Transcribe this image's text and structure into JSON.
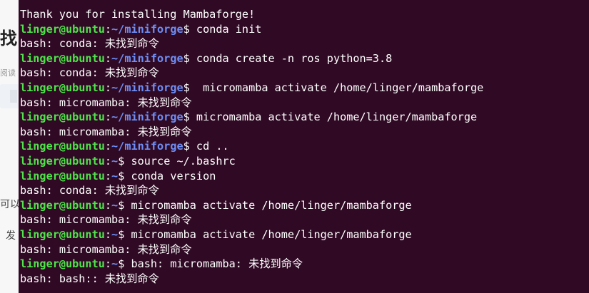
{
  "background_page": {
    "title_fragment": "找",
    "read_fragment": "阅读",
    "fragment_ke": "可以",
    "fragment_fa": "发"
  },
  "terminal": {
    "colors": {
      "background": "#300a24",
      "user": "#4ee44a",
      "path": "#6f8ff7",
      "text": "#ffffff"
    },
    "lines": [
      {
        "type": "output",
        "text": "Thank you for installing Mambaforge!"
      },
      {
        "type": "prompt",
        "user": "linger@ubuntu",
        "sep": ":",
        "path": "~/miniforge",
        "symbol": "$",
        "command": " conda init"
      },
      {
        "type": "output",
        "text": "bash: conda: 未找到命令"
      },
      {
        "type": "prompt",
        "user": "linger@ubuntu",
        "sep": ":",
        "path": "~/miniforge",
        "symbol": "$",
        "command": " conda create -n ros python=3.8"
      },
      {
        "type": "output",
        "text": "bash: conda: 未找到命令"
      },
      {
        "type": "prompt",
        "user": "linger@ubuntu",
        "sep": ":",
        "path": "~/miniforge",
        "symbol": "$",
        "command": "  micromamba activate /home/linger/mambaforge"
      },
      {
        "type": "output",
        "text": "bash: micromamba: 未找到命令"
      },
      {
        "type": "prompt",
        "user": "linger@ubuntu",
        "sep": ":",
        "path": "~/miniforge",
        "symbol": "$",
        "command": " micromamba activate /home/linger/mambaforge"
      },
      {
        "type": "output",
        "text": "bash: micromamba: 未找到命令"
      },
      {
        "type": "prompt",
        "user": "linger@ubuntu",
        "sep": ":",
        "path": "~/miniforge",
        "symbol": "$",
        "command": " cd .."
      },
      {
        "type": "prompt",
        "user": "linger@ubuntu",
        "sep": ":",
        "path": "~",
        "symbol": "$",
        "command": " source ~/.bashrc"
      },
      {
        "type": "prompt",
        "user": "linger@ubuntu",
        "sep": ":",
        "path": "~",
        "symbol": "$",
        "command": " conda version"
      },
      {
        "type": "output",
        "text": "bash: conda: 未找到命令"
      },
      {
        "type": "prompt",
        "user": "linger@ubuntu",
        "sep": ":",
        "path": "~",
        "symbol": "$",
        "command": " micromamba activate /home/linger/mambaforge"
      },
      {
        "type": "output",
        "text": "bash: micromamba: 未找到命令"
      },
      {
        "type": "prompt",
        "user": "linger@ubuntu",
        "sep": ":",
        "path": "~",
        "symbol": "$",
        "command": " micromamba activate /home/linger/mambaforge"
      },
      {
        "type": "output",
        "text": "bash: micromamba: 未找到命令"
      },
      {
        "type": "prompt",
        "user": "linger@ubuntu",
        "sep": ":",
        "path": "~",
        "symbol": "$",
        "command": " bash: micromamba: 未找到命令"
      },
      {
        "type": "output",
        "text": "bash: bash:: 未找到命令"
      }
    ]
  }
}
